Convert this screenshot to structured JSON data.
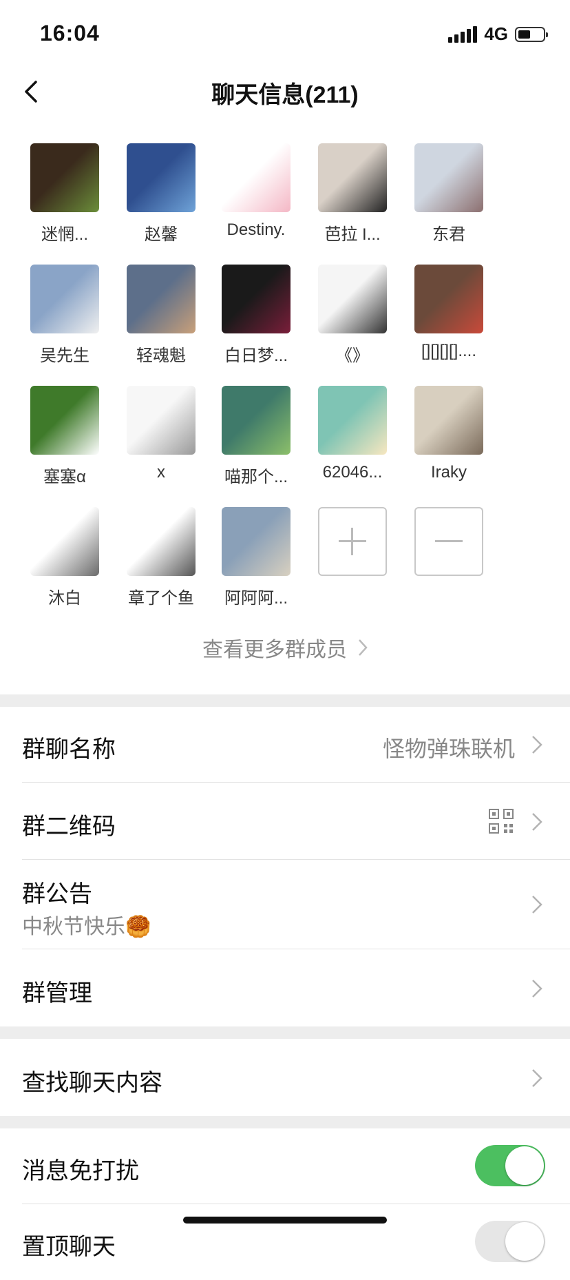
{
  "status": {
    "time": "16:04",
    "network": "4G"
  },
  "nav": {
    "title": "聊天信息(211)"
  },
  "members": [
    {
      "name": "迷惘...",
      "icon": "avatar-photo-boy",
      "colors": [
        "#3a2a1c",
        "#6b8e3a"
      ]
    },
    {
      "name": "赵馨",
      "icon": "avatar-anime-blue",
      "colors": [
        "#2f4f8f",
        "#6fa3d8"
      ]
    },
    {
      "name": "Destiny.",
      "icon": "avatar-pink-pig",
      "colors": [
        "#ffffff",
        "#f4b7c5"
      ]
    },
    {
      "name": "芭拉 I...",
      "icon": "avatar-man-tuxedo",
      "colors": [
        "#d9d0c7",
        "#222222"
      ]
    },
    {
      "name": "东君",
      "icon": "avatar-anime-umbrella",
      "colors": [
        "#cfd6e0",
        "#8c6f6f"
      ]
    },
    {
      "name": "吴先生",
      "icon": "avatar-couple-photo",
      "colors": [
        "#8aa4c7",
        "#f0f0f0"
      ]
    },
    {
      "name": "轻魂魁",
      "icon": "avatar-pavilion",
      "colors": [
        "#5d6f8a",
        "#c9a07a"
      ]
    },
    {
      "name": "白日梦...",
      "icon": "avatar-armored-warrior",
      "colors": [
        "#1a1a1a",
        "#7a1e3a"
      ]
    },
    {
      "name": "《》",
      "icon": "avatar-laughing-men",
      "colors": [
        "#f5f5f5",
        "#333333"
      ]
    },
    {
      "name": "[][][][]....",
      "icon": "avatar-roses-face",
      "colors": [
        "#6b4a3a",
        "#c94a3a"
      ]
    },
    {
      "name": "塞塞α",
      "icon": "avatar-goose",
      "colors": [
        "#3f7a2a",
        "#ffffff"
      ]
    },
    {
      "name": "x",
      "icon": "avatar-bear-sketch",
      "colors": [
        "#f7f7f7",
        "#999999"
      ]
    },
    {
      "name": "喵那个...",
      "icon": "avatar-lake",
      "colors": [
        "#3f7a6a",
        "#8cbf6a"
      ]
    },
    {
      "name": "62046...",
      "icon": "avatar-flowers",
      "colors": [
        "#7fc4b4",
        "#f7e7c0"
      ]
    },
    {
      "name": "Iraky",
      "icon": "avatar-anime-dog",
      "colors": [
        "#d8cfbf",
        "#7a6a5a"
      ]
    },
    {
      "name": "沐白",
      "icon": "avatar-cartoon-character",
      "colors": [
        "#ffffff",
        "#6a6a6a"
      ]
    },
    {
      "name": "章了个鱼",
      "icon": "avatar-dino",
      "colors": [
        "#ffffff",
        "#555555"
      ]
    },
    {
      "name": "阿阿阿...",
      "icon": "avatar-tom-cat",
      "colors": [
        "#8aa0b8",
        "#d8d0c0"
      ]
    }
  ],
  "actions": {
    "add_icon": "plus-icon",
    "remove_icon": "minus-icon"
  },
  "more_members": "查看更多群成员",
  "settings": {
    "group_name_label": "群聊名称",
    "group_name_value": "怪物弹珠联机",
    "qr_label": "群二维码",
    "notice_label": "群公告",
    "notice_value": "中秋节快乐🥮",
    "manage_label": "群管理",
    "search_label": "查找聊天内容",
    "mute_label": "消息免打扰",
    "mute_on": true,
    "pin_label": "置顶聊天"
  },
  "colors": {
    "toggle_on": "#4cbf60",
    "separator": "#ededed"
  }
}
